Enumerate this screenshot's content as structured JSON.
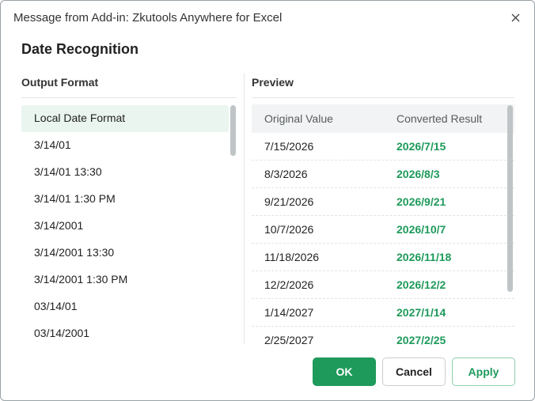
{
  "window": {
    "title": "Message from Add-in: Zkutools Anywhere for Excel",
    "close_icon": "close-icon"
  },
  "dialog": {
    "heading": "Date Recognition"
  },
  "output_format": {
    "label": "Output Format",
    "items": [
      "Local Date Format",
      "3/14/01",
      "3/14/01 13:30",
      "3/14/01 1:30 PM",
      "3/14/2001",
      "3/14/2001 13:30",
      "3/14/2001 1:30 PM",
      "03/14/01",
      "03/14/2001"
    ],
    "selected_index": 0
  },
  "preview": {
    "label": "Preview",
    "columns": [
      "Original Value",
      "Converted Result"
    ],
    "rows": [
      [
        "7/15/2026",
        "2026/7/15"
      ],
      [
        "8/3/2026",
        "2026/8/3"
      ],
      [
        "9/21/2026",
        "2026/9/21"
      ],
      [
        "10/7/2026",
        "2026/10/7"
      ],
      [
        "11/18/2026",
        "2026/11/18"
      ],
      [
        "12/2/2026",
        "2026/12/2"
      ],
      [
        "1/14/2027",
        "2027/1/14"
      ],
      [
        "2/25/2027",
        "2027/2/25"
      ]
    ]
  },
  "buttons": {
    "ok": "OK",
    "cancel": "Cancel",
    "apply": "Apply"
  },
  "colors": {
    "accent": "#1e9a5b",
    "selected_bg": "#eaf5f0",
    "header_bg": "#f2f3f4"
  }
}
